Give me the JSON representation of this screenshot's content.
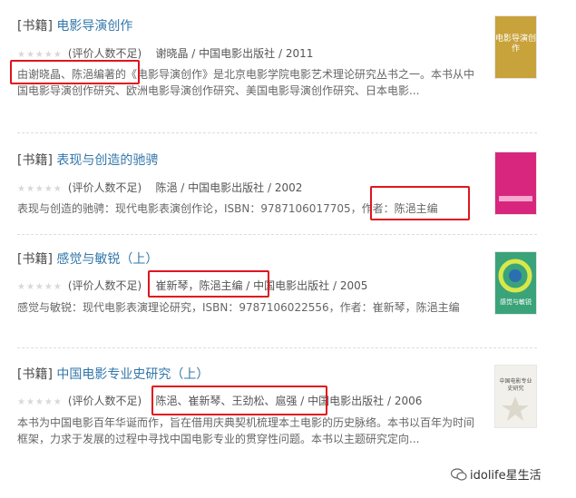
{
  "results": [
    {
      "tag": "[书籍]",
      "title": "电影导演创作",
      "rating": "(评价人数不足)",
      "meta": "谢晓晶 / 中国电影出版社 / 2011",
      "desc": "由谢晓晶、陈浥编著的《电影导演创作》是北京电影学院电影艺术理论研究丛书之一。本书从中国电影导演创作研究、欧洲电影导演创作研究、美国电影导演创作研究、日本电影...",
      "cover": {
        "bg": "#c8a23a",
        "text": "电影导演创作"
      }
    },
    {
      "tag": "[书籍]",
      "title": "表现与创造的驰骋",
      "rating": "(评价人数不足)",
      "meta": "陈浥 / 中国电影出版社 / 2002",
      "desc": "表现与创造的驰骋：现代电影表演创作论，ISBN：9787106017705，作者：陈浥主编",
      "cover": {
        "bg": "#d8267e",
        "text": ""
      }
    },
    {
      "tag": "[书籍]",
      "title": "感觉与敏锐（上）",
      "rating": "(评价人数不足)",
      "meta": "崔新琴，陈浥主编 / 中国电影出版社 / 2005",
      "desc": "感觉与敏锐：现代电影表演理论研究，ISBN：9787106022556，作者：崔新琴，陈浥主编",
      "cover": {
        "bg": "#3aa37a",
        "text": "感觉与敏锐"
      }
    },
    {
      "tag": "[书籍]",
      "title": "中国电影专业史研究（上）",
      "rating": "(评价人数不足)",
      "meta": "陈浥、崔新琴、王劲松、扈强 / 中国电影出版社 / 2006",
      "desc": "本书为中国电影百年华诞而作，旨在借用庆典契机梳理本土电影的历史脉络。本书以百年为时间框架，力求于发展的过程中寻找中国电影专业的贯穿性问题。本书以主题研究定向...",
      "cover": {
        "bg": "#f2f0ea",
        "text": "中国电影专业史研究"
      }
    }
  ],
  "stars": "★★★★★",
  "watermark": "idolife星生活",
  "colors": {
    "link": "#3377aa",
    "highlight": "#e0141e"
  }
}
